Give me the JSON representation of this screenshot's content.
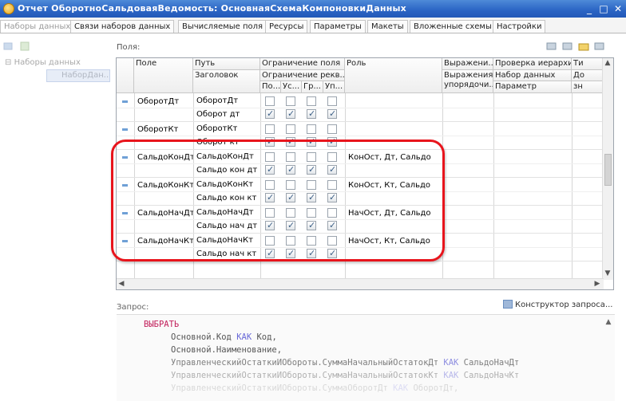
{
  "window": {
    "title": "Отчет ОборотноСальдоваяВедомость: ОсновнаяСхемаКомпоновкиДанных",
    "minimize": "_",
    "maximize": "□",
    "close": "✕"
  },
  "tabs": [
    {
      "label": "Наборы данных",
      "active": true
    },
    {
      "label": "Связи наборов данных",
      "active": false
    },
    {
      "label": "Вычисляемые поля",
      "active": false
    },
    {
      "label": "Ресурсы",
      "active": false
    },
    {
      "label": "Параметры",
      "active": false
    },
    {
      "label": "Макеты",
      "active": false
    },
    {
      "label": "Вложенные схемы",
      "active": false
    },
    {
      "label": "Настройки",
      "active": false
    }
  ],
  "tree": {
    "root": "Наборы данных",
    "child": "НаборДан..."
  },
  "fields_label": "Поля:",
  "grid": {
    "headers": {
      "field": "Поле",
      "path": "Путь",
      "title": "Заголовок",
      "restriction_field": "Ограничение поля",
      "restriction_req": "Ограничение рекв...",
      "sub": [
        "По...",
        "Ус...",
        "Гр...",
        "Уп..."
      ],
      "role": "Роль",
      "expr": "Выражени...",
      "expr_order": "Выражения упорядочи...",
      "hier_check": "Проверка иерархии:",
      "dataset": "Набор данных",
      "param": "Параметр",
      "extra1": "Ти",
      "extra2": "До",
      "extra3": "зн"
    },
    "rows": [
      {
        "field": "ОборотДт",
        "path": "ОборотДт",
        "title": "Оборот дт",
        "role": "",
        "top": [
          false,
          false,
          false,
          false
        ],
        "bottom": [
          true,
          true,
          true,
          true
        ]
      },
      {
        "field": "ОборотКт",
        "path": "ОборотКт",
        "title": "Оборот кт",
        "role": "",
        "top": [
          false,
          false,
          false,
          false
        ],
        "bottom": [
          true,
          true,
          true,
          true
        ]
      },
      {
        "field": "СальдоКонДт",
        "path": "СальдоКонДт",
        "title": "Сальдо кон дт",
        "role": "КонОст, Дт, Сальдо",
        "top": [
          false,
          false,
          false,
          false
        ],
        "bottom": [
          true,
          true,
          true,
          true
        ]
      },
      {
        "field": "СальдоКонКт",
        "path": "СальдоКонКт",
        "title": "Сальдо кон кт",
        "role": "КонОст, Кт, Сальдо",
        "top": [
          false,
          false,
          false,
          false
        ],
        "bottom": [
          true,
          true,
          true,
          true
        ]
      },
      {
        "field": "СальдоНачДт",
        "path": "СальдоНачДт",
        "title": "Сальдо нач дт",
        "role": "НачОст, Дт, Сальдо",
        "top": [
          false,
          false,
          false,
          false
        ],
        "bottom": [
          true,
          true,
          true,
          true
        ]
      },
      {
        "field": "СальдоНачКт",
        "path": "СальдоНачКт",
        "title": "Сальдо нач кт",
        "role": "НачОст, Кт, Сальдо",
        "top": [
          false,
          false,
          false,
          false
        ],
        "bottom": [
          true,
          true,
          true,
          true
        ]
      }
    ]
  },
  "query_label": "Запрос:",
  "constructor_button": "Конструктор запроса...",
  "query": {
    "select_kw": "ВЫБРАТЬ",
    "lines": [
      {
        "pre": "Основной.Код ",
        "kw": "КАК",
        "post": " Код,"
      },
      {
        "pre": "Основной.Наименование,",
        "kw": "",
        "post": ""
      },
      {
        "pre": "УправленческийОстаткиИОбороты.СуммаНачальныйОстатокДт ",
        "kw": "КАК",
        "post": " СальдоНачДт"
      },
      {
        "pre": "УправленческийОстаткиИОбороты.СуммаНачальныйОстатокКт ",
        "kw": "КАК",
        "post": " СальдоНачКт"
      },
      {
        "pre": "УправленческийОстаткиИОбороты.СуммаОборотДт ",
        "kw": "КАК",
        "post": " ОборотДт,"
      }
    ]
  },
  "colors": {
    "titlebar": "#2a64c4",
    "highlight": "#e8141c",
    "keyword": "#c2205b"
  }
}
